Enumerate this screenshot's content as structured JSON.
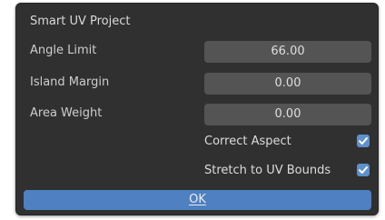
{
  "dialog": {
    "title": "Smart UV Project",
    "fields": [
      {
        "label": "Angle Limit",
        "value": "66.00"
      },
      {
        "label": "Island Margin",
        "value": "0.00"
      },
      {
        "label": "Area Weight",
        "value": "0.00"
      }
    ],
    "checkboxes": [
      {
        "label": "Correct Aspect",
        "checked": true
      },
      {
        "label": "Stretch to UV Bounds",
        "checked": true
      }
    ],
    "ok_label": "OK"
  },
  "colors": {
    "panel_bg": "#303030",
    "field_bg": "#545454",
    "accent": "#4f80c2",
    "checkbox": "#5e90cc"
  },
  "icons": {
    "checkmark": "check-icon"
  }
}
